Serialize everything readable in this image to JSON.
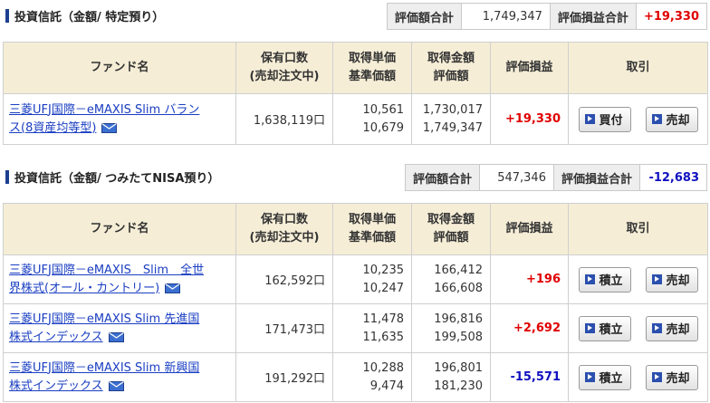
{
  "sections": [
    {
      "title": "投資信託（金額/ 特定預り）",
      "summary": {
        "total_label": "評価額合計",
        "total_value": "1,749,347",
        "pl_label": "評価損益合計",
        "pl_value": "+19,330"
      },
      "headers": {
        "fund": "ファンド名",
        "units_1": "保有口数",
        "units_2": "(売却注文中)",
        "price_1": "取得単価",
        "price_2": "基準価額",
        "amount_1": "取得金額",
        "amount_2": "評価額",
        "pl": "評価損益",
        "trade": "取引"
      },
      "rows": [
        {
          "fund_line1": "三菱UFJ国際－eMAXIS Slim バラン",
          "fund_line2": "ス(8資産均等型)",
          "units": "1,638,119口",
          "acq_price": "10,561",
          "base_price": "10,679",
          "acq_amount": "1,730,017",
          "eval_amount": "1,749,347",
          "pl": "+19,330",
          "buy_label": "買付",
          "sell_label": "売却"
        }
      ]
    },
    {
      "title": "投資信託（金額/ つみたてNISA預り）",
      "summary": {
        "total_label": "評価額合計",
        "total_value": "547,346",
        "pl_label": "評価損益合計",
        "pl_value": "-12,683"
      },
      "headers": {
        "fund": "ファンド名",
        "units_1": "保有口数",
        "units_2": "(売却注文中)",
        "price_1": "取得単価",
        "price_2": "基準価額",
        "amount_1": "取得金額",
        "amount_2": "評価額",
        "pl": "評価損益",
        "trade": "取引"
      },
      "rows": [
        {
          "fund_line1": "三菱UFJ国際－eMAXIS　Slim　全世",
          "fund_line2": "界株式(オール・カントリー)",
          "units": "162,592口",
          "acq_price": "10,235",
          "base_price": "10,247",
          "acq_amount": "166,412",
          "eval_amount": "166,608",
          "pl": "+196",
          "buy_label": "積立",
          "sell_label": "売却"
        },
        {
          "fund_line1": "三菱UFJ国際－eMAXIS Slim 先進国",
          "fund_line2": "株式インデックス",
          "units": "171,473口",
          "acq_price": "11,478",
          "base_price": "11,635",
          "acq_amount": "196,816",
          "eval_amount": "199,508",
          "pl": "+2,692",
          "buy_label": "積立",
          "sell_label": "売却"
        },
        {
          "fund_line1": "三菱UFJ国際－eMAXIS Slim 新興国",
          "fund_line2": "株式インデックス",
          "units": "191,292口",
          "acq_price": "10,288",
          "base_price": "9,474",
          "acq_amount": "196,801",
          "eval_amount": "181,230",
          "pl": "-15,571",
          "buy_label": "積立",
          "sell_label": "売却"
        }
      ]
    }
  ],
  "icons": {
    "mail": "mail-icon",
    "arrow": "play-arrow-icon"
  },
  "colors": {
    "positive": "#e00000",
    "negative": "#1010c0",
    "header_bg": "#f5edd6",
    "link": "#1a3ec2",
    "section_bar": "#1d3f8f"
  }
}
